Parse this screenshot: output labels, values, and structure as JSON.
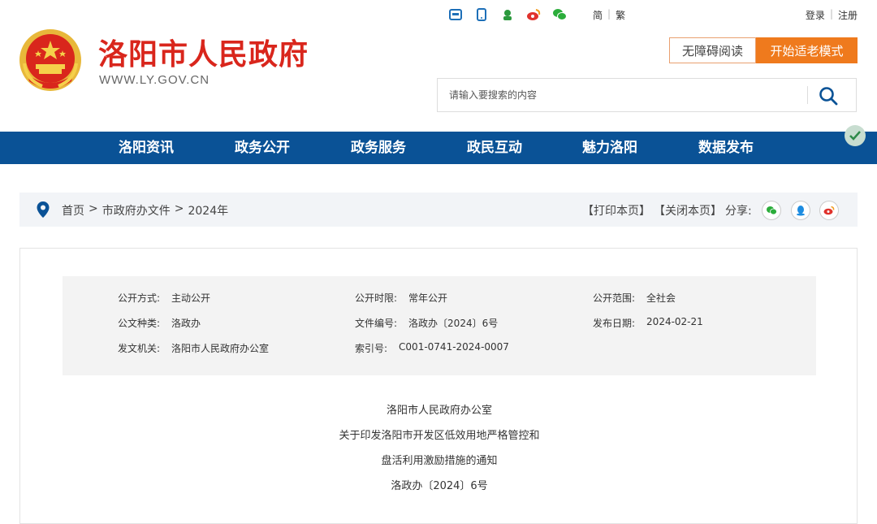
{
  "header": {
    "site_title": "洛阳市人民政府",
    "site_url": "WWW.LY.GOV.CN",
    "top_icons": [
      "app-icon",
      "mobile-icon",
      "robot-icon",
      "weibo-icon",
      "wechat-icon"
    ],
    "lang": {
      "simplified": "简",
      "traditional": "繁",
      "separator": "|"
    },
    "auth": {
      "login": "登录",
      "register": "注册",
      "separator": "|"
    },
    "accessibility_label": "无障碍阅读",
    "elder_mode_label": "开始适老模式",
    "search": {
      "placeholder": "请输入要搜索的内容"
    }
  },
  "nav": {
    "items": [
      "洛阳资讯",
      "政务公开",
      "政务服务",
      "政民互动",
      "魅力洛阳",
      "数据发布"
    ]
  },
  "breadcrumb": {
    "items": [
      "首页",
      "市政府办文件",
      "2024年"
    ],
    "separator": ">",
    "print_label": "【打印本页】",
    "close_label": "【关闭本页】",
    "share_label": "分享:"
  },
  "meta": {
    "row1": [
      {
        "label": "公开方式:",
        "value": "主动公开"
      },
      {
        "label": "公开时限:",
        "value": "常年公开"
      },
      {
        "label": "公开范围:",
        "value": "全社会"
      }
    ],
    "row2": [
      {
        "label": "公文种类:",
        "value": "洛政办"
      },
      {
        "label": "文件编号:",
        "value": "洛政办〔2024〕6号"
      },
      {
        "label": "发布日期:",
        "value": "2024-02-21"
      }
    ],
    "row3": [
      {
        "label": "发文机关:",
        "value": "洛阳市人民政府办公室"
      },
      {
        "label": "索引号:",
        "value": "C001-0741-2024-0007"
      }
    ]
  },
  "document": {
    "issuer": "洛阳市人民政府办公室",
    "title_line1": "关于印发洛阳市开发区低效用地严格管控和",
    "title_line2": "盘活利用激励措施的通知",
    "doc_number": "洛政办〔2024〕6号"
  },
  "colors": {
    "title_red": "#d9261c",
    "nav_blue": "#0a5296",
    "elder_orange": "#ef7a1d"
  }
}
